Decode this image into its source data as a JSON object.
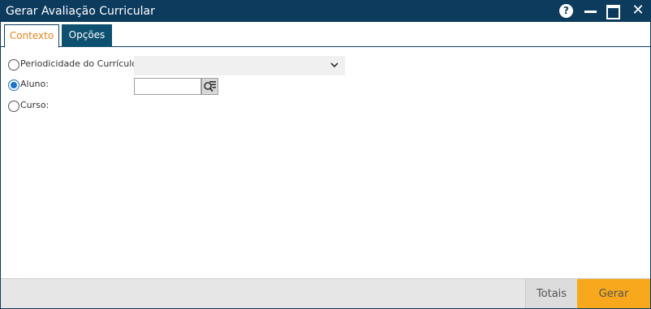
{
  "window": {
    "title": "Gerar Avaliação Curricular",
    "help_label": "?",
    "close_label": "✕"
  },
  "tabs": [
    {
      "label": "Contexto",
      "active": true
    },
    {
      "label": "Opções",
      "active": false
    }
  ],
  "form": {
    "periodicidade": {
      "label": "Periodicidade do Currículo:",
      "selected": false,
      "value": ""
    },
    "aluno": {
      "label": "Aluno:",
      "selected": true,
      "value": ""
    },
    "curso": {
      "label": "Curso:",
      "selected": false
    }
  },
  "footer": {
    "totais_label": "Totais",
    "gerar_label": "Gerar"
  },
  "colors": {
    "titlebar": "#0d3b5e",
    "active_tab_text": "#e8821c",
    "inactive_tab_bg": "#0d5070",
    "primary_button": "#f7a81c",
    "radio_checked": "#1a73c8"
  },
  "icons": [
    "help-icon",
    "minimize-icon",
    "maximize-icon",
    "close-icon",
    "chevron-down-icon",
    "lookup-search-icon"
  ]
}
